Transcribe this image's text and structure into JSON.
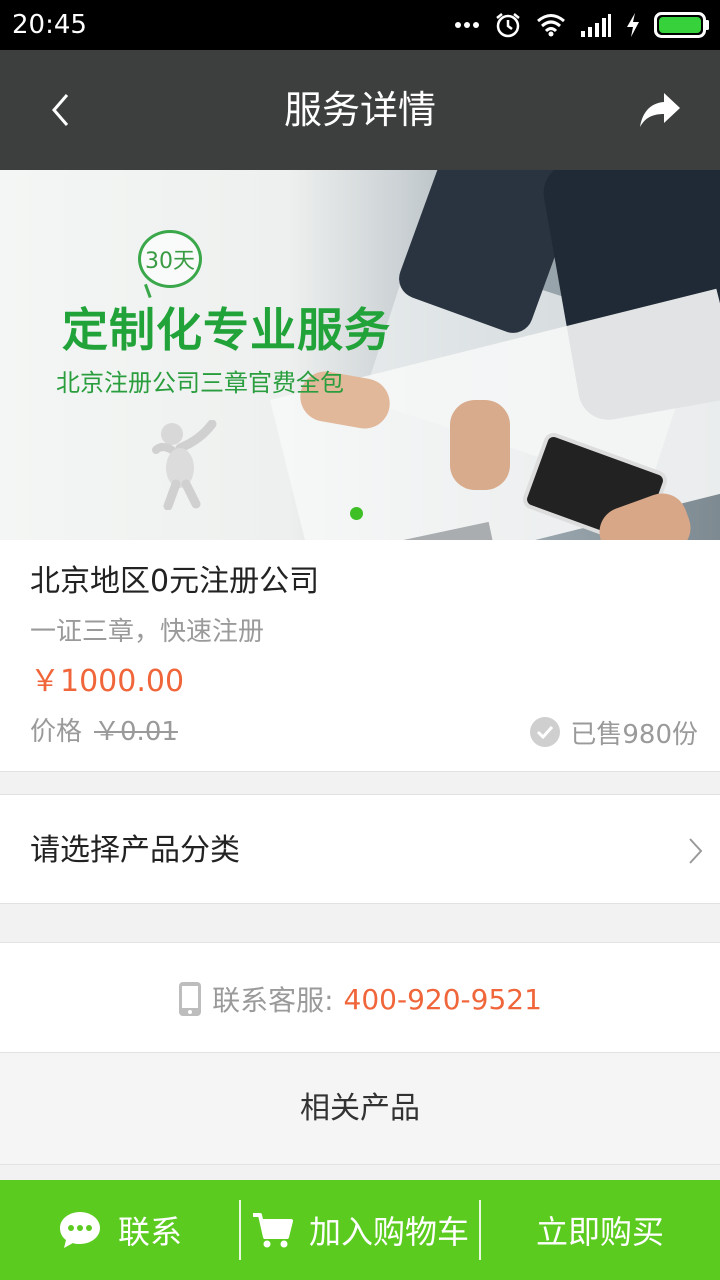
{
  "status_bar": {
    "time": "20:45",
    "icons": [
      "more-dots-icon",
      "alarm-icon",
      "wifi-icon",
      "signal-icon",
      "charging-icon",
      "battery-icon"
    ]
  },
  "navbar": {
    "title": "服务详情",
    "back_icon": "chevron-left-icon",
    "share_icon": "share-arrow-icon"
  },
  "banner": {
    "badge": "30天",
    "headline": "定制化专业服务",
    "subline": "北京注册公司三章官费全包",
    "indicator_color": "#3fbf26"
  },
  "product": {
    "name": "北京地区0元注册公司",
    "description": "一证三章，快速注册",
    "price": "￥1000.00",
    "original_label": "价格",
    "original_price": "￥0.01",
    "sold": "已售980份"
  },
  "category": {
    "label": "请选择产品分类"
  },
  "contact": {
    "label": "联系客服:",
    "phone": "400-920-9521"
  },
  "related": {
    "label": "相关产品"
  },
  "actions": {
    "contact_label": "联系",
    "cart_label": "加入购物车",
    "buy_label": "立即购买"
  },
  "colors": {
    "accent_green": "#5ccb1f",
    "price_orange": "#f0663a",
    "navbar_bg": "#3d3f3e"
  }
}
